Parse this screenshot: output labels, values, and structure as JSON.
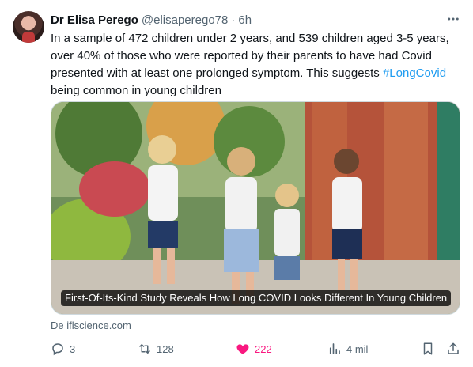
{
  "tweet": {
    "author_name": "Dr Elisa Perego",
    "author_handle": "@elisaperego78",
    "separator": "·",
    "time": "6h",
    "text_before": "In a sample of 472 children under 2 years, and 539 children aged 3-5 years, over 40% of those who were reported by their parents to have had Covid presented with at least one prolonged symptom. This suggests ",
    "hashtag": "#LongCovid",
    "text_after": " being common in young children"
  },
  "card": {
    "title": "First-Of-Its-Kind Study Reveals How Long COVID Looks Different In Young Children",
    "source": "De iflscience.com",
    "image_description_icon": "children-running-photo"
  },
  "actions": {
    "replies": "3",
    "retweets": "128",
    "likes": "222",
    "views": "4 mil"
  },
  "icons": {
    "more": "more-icon",
    "reply": "reply-icon",
    "retweet": "retweet-icon",
    "like": "heart-icon",
    "views": "views-icon",
    "bookmark": "bookmark-icon",
    "share": "share-icon"
  },
  "colors": {
    "text": "#0f1419",
    "muted": "#536471",
    "link": "#1d9bf0",
    "like": "#f91880",
    "border": "#cfd9de"
  }
}
